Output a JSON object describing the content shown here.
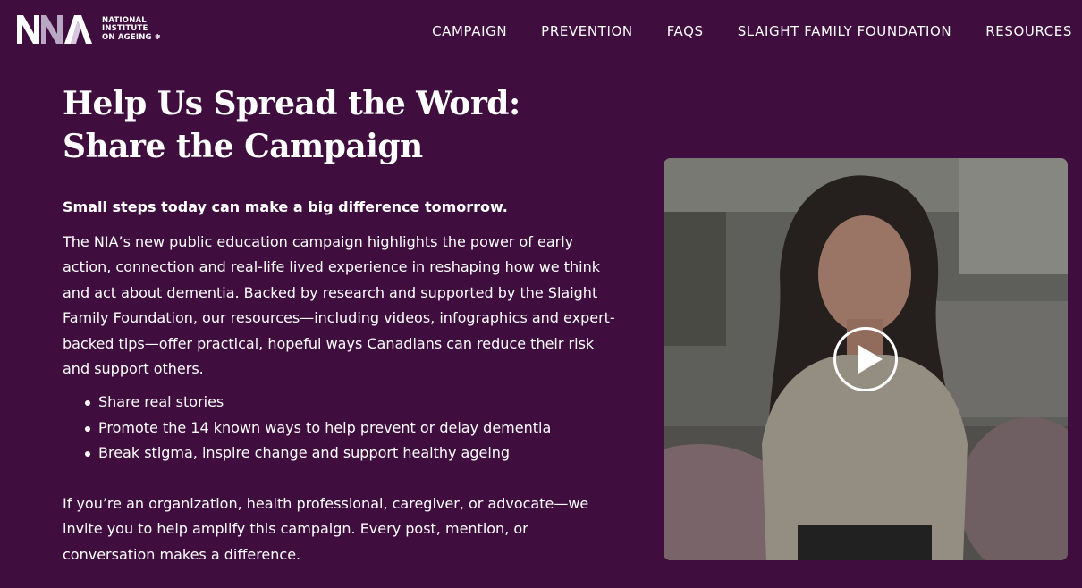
{
  "brand": {
    "logo_lines": [
      "NATIONAL",
      "INSTITUTE",
      "ON AGEING"
    ],
    "maple_glyph": "✽"
  },
  "nav": {
    "items": [
      "CAMPAIGN",
      "PREVENTION",
      "FAQS",
      "SLAIGHT FAMILY FOUNDATION",
      "RESOURCES"
    ]
  },
  "main": {
    "title": "Help Us Spread the Word: Share the Campaign",
    "lead": "Small steps today can make a big difference tomorrow.",
    "body": "The NIA’s new public education campaign highlights the power of early action, connection and real-life lived experience in reshaping how we think and act about dementia. Backed by research and supported by the Slaight Family Foundation, our resources—including videos, infographics and expert-backed tips—offer practical, hopeful ways Canadians can reduce their risk and support others.",
    "bullets": [
      "Share real stories",
      "Promote the 14 known ways to help prevent or delay dementia",
      "Break stigma, inspire change and support healthy ageing"
    ],
    "closing": "If you’re an organization, health professional, caregiver, or advocate—we invite you to help amplify this campaign. Every post, mention, or conversation makes a difference."
  },
  "video": {
    "play_icon": "play-icon"
  },
  "colors": {
    "background": "#3f0e3f",
    "text": "#ffffff",
    "logo_accent": "#b9a7c4"
  }
}
